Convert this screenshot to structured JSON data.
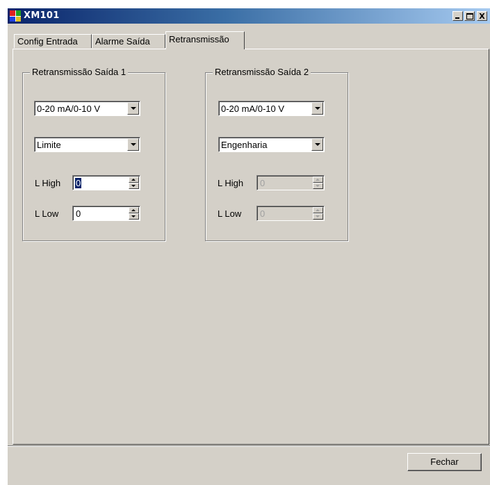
{
  "window": {
    "title": "XM101",
    "icon": "app-icon"
  },
  "title_buttons": {
    "minimize": "minimize-icon",
    "maximize": "maximize-icon",
    "close_label": "X"
  },
  "tabs": [
    {
      "label": "Config Entrada",
      "active": false
    },
    {
      "label": "Alarme Saída",
      "active": false
    },
    {
      "label": "Retransmissão",
      "active": true
    }
  ],
  "output1": {
    "group_title": "Retransmissão Saída 1",
    "range_value": "0-20 mA/0-10 V",
    "mode_value": "Limite",
    "l_high_label": "L High",
    "l_high_value": "0",
    "l_low_label": "L Low",
    "l_low_value": "0"
  },
  "output2": {
    "group_title": "Retransmissão Saída  2",
    "range_value": "0-20 mA/0-10 V",
    "mode_value": "Engenharia",
    "l_high_label": "L High",
    "l_high_value": "0",
    "l_low_label": "L Low",
    "l_low_value": "0"
  },
  "footer": {
    "close_button": "Fechar"
  }
}
